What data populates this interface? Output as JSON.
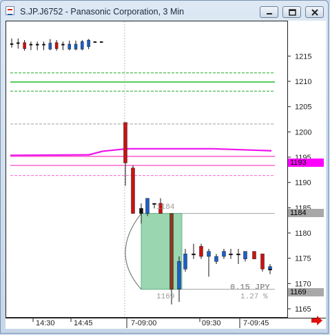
{
  "window": {
    "title": "S.JP.J6752 - Panasonic Corporation, 3 Min",
    "buttons": [
      "minimize",
      "restore",
      "close"
    ]
  },
  "chart_data": {
    "type": "candlestick",
    "symbol": "S.JP.J6752",
    "company": "Panasonic Corporation",
    "interval": "3 Min",
    "y_ticks": [
      1215,
      1210,
      1205,
      1200,
      1195,
      1190,
      1185,
      1180,
      1175,
      1170,
      1165
    ],
    "ylim": [
      1163.5,
      1222
    ],
    "x_ticks": [
      "14:30",
      "14:45",
      "7-09:00",
      "09:30",
      "7-09:45"
    ],
    "price_badges": [
      {
        "value": "1193",
        "color": "#ff00ff",
        "text_color": "#000000"
      },
      {
        "value": "1184",
        "color": "#a8a8a8",
        "text_color": "#000000"
      },
      {
        "value": "1169",
        "color": "#a8a8a8",
        "text_color": "#000000"
      }
    ],
    "annotations": {
      "box_top_label": "1184",
      "box_bottom_label": "1169",
      "change": "0.15 JPY",
      "change_pct": "1.27 %"
    },
    "candles_previous_session": [
      {
        "o": 1217.6,
        "h": 1218.6,
        "l": 1216.8,
        "c": 1217.6,
        "color": "black"
      },
      {
        "o": 1217.8,
        "h": 1218.6,
        "l": 1216.6,
        "c": 1217.6,
        "color": "black"
      },
      {
        "o": 1217.8,
        "h": 1218.3,
        "l": 1216.2,
        "c": 1216.6,
        "color": "red"
      },
      {
        "o": 1217.5,
        "h": 1218.0,
        "l": 1216.3,
        "c": 1217.5,
        "color": "black"
      },
      {
        "o": 1217.5,
        "h": 1218.0,
        "l": 1216.3,
        "c": 1217.5,
        "color": "black"
      },
      {
        "o": 1217.5,
        "h": 1218.0,
        "l": 1216.3,
        "c": 1217.5,
        "color": "black"
      },
      {
        "o": 1216.5,
        "h": 1218.5,
        "l": 1216.3,
        "c": 1217.7,
        "color": "blue"
      },
      {
        "o": 1217.8,
        "h": 1218.3,
        "l": 1216.2,
        "c": 1216.6,
        "color": "red"
      },
      {
        "o": 1217.5,
        "h": 1218.0,
        "l": 1216.3,
        "c": 1217.5,
        "color": "black"
      },
      {
        "o": 1216.5,
        "h": 1218.2,
        "l": 1216.3,
        "c": 1217.5,
        "color": "blue"
      },
      {
        "o": 1216.5,
        "h": 1218.2,
        "l": 1216.3,
        "c": 1217.5,
        "color": "blue"
      },
      {
        "o": 1216.5,
        "h": 1218.3,
        "l": 1216.3,
        "c": 1218.0,
        "color": "blue"
      },
      {
        "o": 1217.0,
        "h": 1218.5,
        "l": 1216.5,
        "c": 1218.3,
        "color": "blue"
      },
      {
        "o": 1218.0,
        "h": 1218.0,
        "l": 1218.0,
        "c": 1218.0,
        "color": "black"
      },
      {
        "o": 1218.0,
        "h": 1218.0,
        "l": 1218.0,
        "c": 1218.0,
        "color": "black"
      }
    ],
    "candles_current_session": [
      {
        "o": 1202.0,
        "h": 1202.0,
        "l": 1189.5,
        "c": 1194.0,
        "color": "red"
      },
      {
        "o": 1193.0,
        "h": 1193.5,
        "l": 1184.0,
        "c": 1184.0,
        "color": "red"
      },
      {
        "o": 1184.0,
        "h": 1186.0,
        "l": 1182.0,
        "c": 1185.0,
        "color": "black"
      },
      {
        "o": 1184.0,
        "h": 1187.0,
        "l": 1183.5,
        "c": 1187.0,
        "color": "blue"
      },
      {
        "o": 1186.0,
        "h": 1186.0,
        "l": 1185.0,
        "c": 1186.0,
        "color": "black"
      },
      {
        "o": 1186.0,
        "h": 1187.0,
        "l": 1184.0,
        "c": 1184.0,
        "color": "red"
      },
      {
        "o": 1184.0,
        "h": 1184.0,
        "l": 1166.0,
        "c": 1169.0,
        "color": "brown"
      },
      {
        "o": 1169.0,
        "h": 1175.5,
        "l": 1166.5,
        "c": 1174.5,
        "color": "blue"
      },
      {
        "o": 1173.0,
        "h": 1177.0,
        "l": 1172.5,
        "c": 1176.0,
        "color": "blue"
      },
      {
        "o": 1176.0,
        "h": 1178.0,
        "l": 1175.0,
        "c": 1176.0,
        "color": "black"
      },
      {
        "o": 1177.5,
        "h": 1178.0,
        "l": 1175.0,
        "c": 1175.5,
        "color": "red"
      },
      {
        "o": 1175.5,
        "h": 1177.0,
        "l": 1171.5,
        "c": 1176.5,
        "color": "blue"
      },
      {
        "o": 1175.5,
        "h": 1176.0,
        "l": 1174.0,
        "c": 1174.5,
        "color": "blue"
      },
      {
        "o": 1175.5,
        "h": 1177.0,
        "l": 1175.0,
        "c": 1176.5,
        "color": "blue"
      },
      {
        "o": 1176.0,
        "h": 1177.0,
        "l": 1175.0,
        "c": 1176.0,
        "color": "black"
      },
      {
        "o": 1176.0,
        "h": 1177.0,
        "l": 1174.0,
        "c": 1176.0,
        "color": "black"
      },
      {
        "o": 1175.0,
        "h": 1176.5,
        "l": 1174.5,
        "c": 1176.5,
        "color": "blue"
      },
      {
        "o": 1176.5,
        "h": 1176.5,
        "l": 1175.0,
        "c": 1175.0,
        "color": "red"
      },
      {
        "o": 1176.0,
        "h": 1176.0,
        "l": 1172.5,
        "c": 1173.0,
        "color": "red"
      },
      {
        "o": 1173.0,
        "h": 1174.0,
        "l": 1172.0,
        "c": 1173.0,
        "color": "black"
      },
      {
        "o": 1173.0,
        "h": 1174.0,
        "l": 1172.0,
        "c": 1173.5,
        "color": "blue"
      }
    ],
    "levels": [
      {
        "value": 1211.8,
        "color": "#22aa22",
        "style": "dashed"
      },
      {
        "value": 1210.0,
        "color": "#22bb22",
        "style": "solid"
      },
      {
        "value": 1208.2,
        "color": "#22aa22",
        "style": "dashed"
      },
      {
        "value": 1201.7,
        "color": "#a0a0a0",
        "style": "dashed"
      },
      {
        "value": 1195.3,
        "color": "#ff66cc",
        "style": "solid"
      },
      {
        "value": 1193.5,
        "color": "#ff66cc",
        "style": "solid"
      },
      {
        "value": 1191.5,
        "color": "#ff66cc",
        "style": "dashed"
      },
      {
        "value": 1184.0,
        "color": "#a0a0a0",
        "style": "solid"
      },
      {
        "value": 1169.0,
        "color": "#a0a0a0",
        "style": "solid"
      }
    ]
  }
}
